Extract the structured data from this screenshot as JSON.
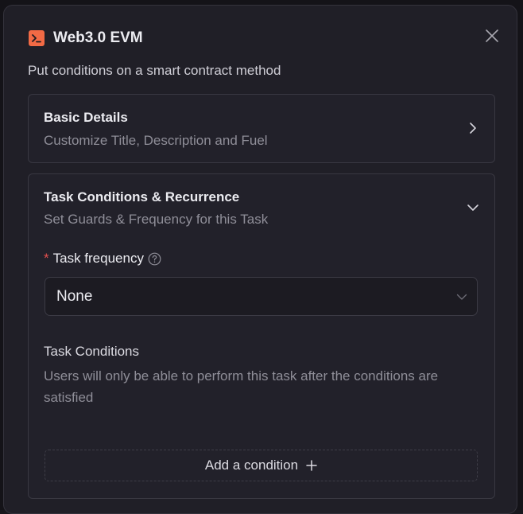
{
  "dialog": {
    "title": "Web3.0 EVM",
    "subtitle": "Put conditions on a smart contract method",
    "app_icon": "terminal-icon",
    "close_icon": "close-icon",
    "accent_color": "#f26a45"
  },
  "basic_details": {
    "title": "Basic Details",
    "description": "Customize Title, Description and Fuel",
    "expand_icon": "chevron-right-icon"
  },
  "task_conditions_section": {
    "title": "Task Conditions & Recurrence",
    "description": "Set Guards & Frequency for this Task",
    "collapse_icon": "chevron-down-icon",
    "frequency": {
      "required_mark": "*",
      "label": "Task frequency",
      "help_icon": "question-circle-icon",
      "selected_value": "None"
    },
    "conditions": {
      "title": "Task Conditions",
      "description": "Users will only be able to perform this task after the conditions are satisfied",
      "add_button_label": "Add a condition",
      "add_icon": "plus-icon"
    }
  }
}
